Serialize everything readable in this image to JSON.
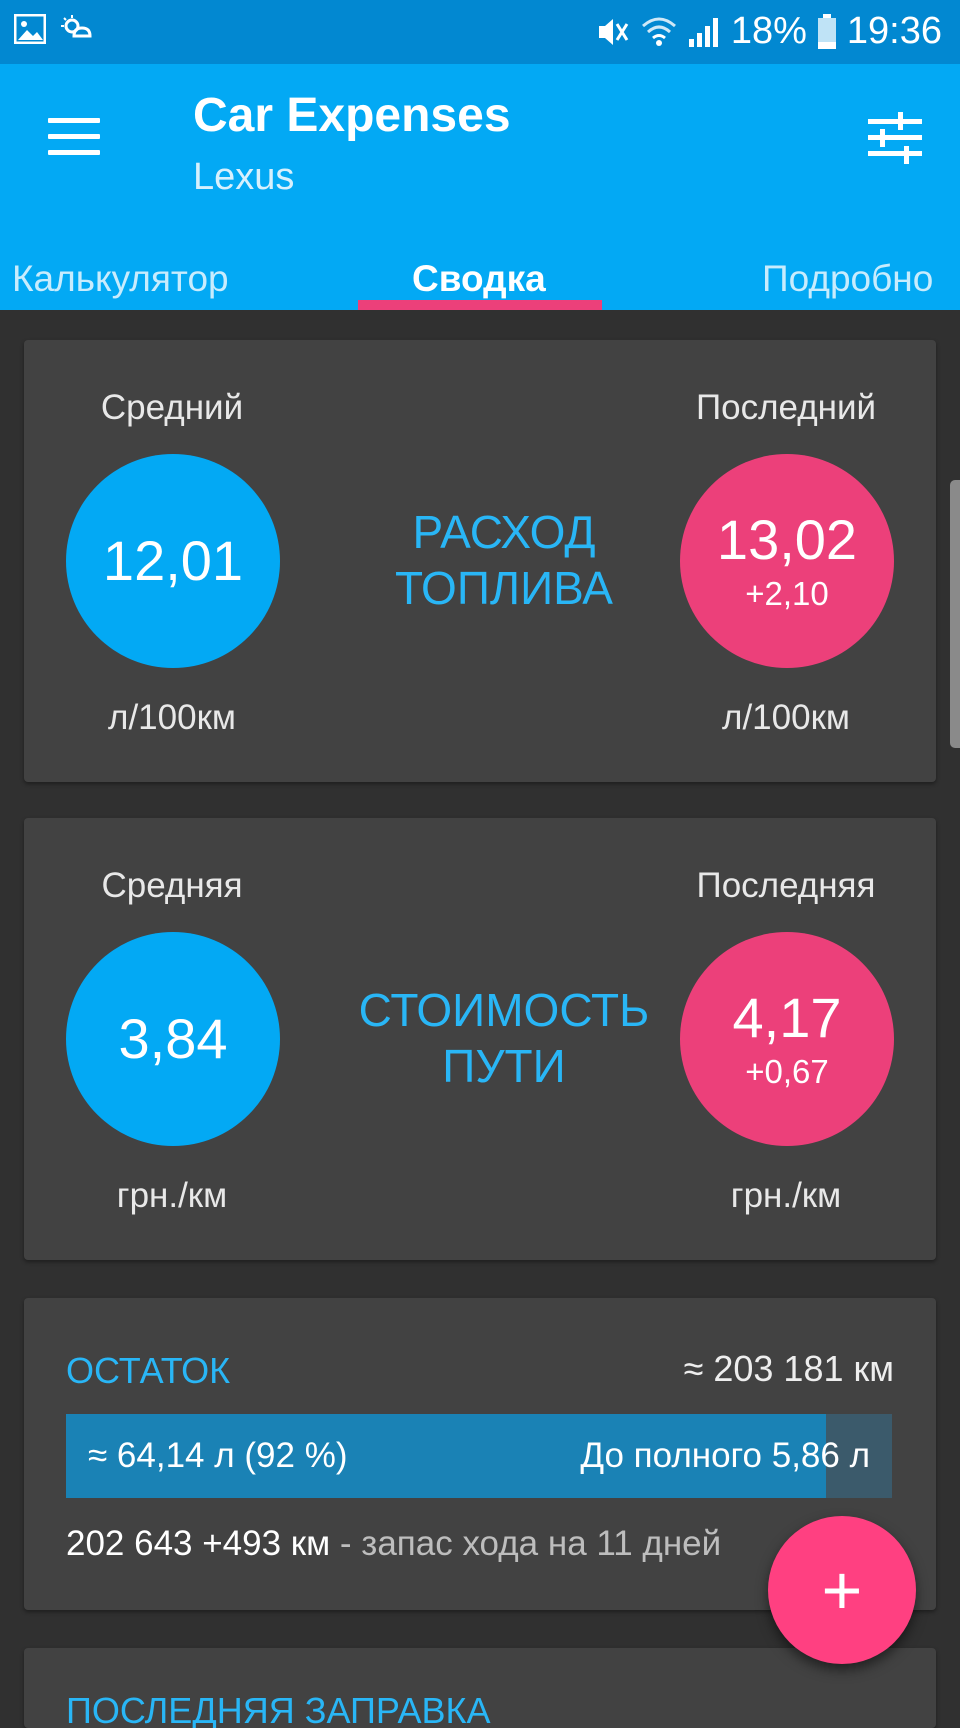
{
  "status_bar": {
    "battery": "18%",
    "time": "19:36",
    "icons": [
      "image-icon",
      "weather-icon",
      "mute-icon",
      "wifi-icon",
      "signal-icon",
      "battery-icon"
    ]
  },
  "app_bar": {
    "title": "Car Expenses",
    "subtitle": "Lexus",
    "menu_icon": "hamburger-menu-icon",
    "filter_icon": "filter-sliders-icon",
    "colors": {
      "primary": "#03a9f4",
      "accent": "#ec407a"
    }
  },
  "tabs": [
    {
      "label": "Калькулятор"
    },
    {
      "label": "Сводка",
      "active": true
    },
    {
      "label": "Подробно"
    }
  ],
  "fuel_card": {
    "left_label": "Средний",
    "right_label": "Последний",
    "avg_value": "12,01",
    "last_value": "13,02",
    "last_delta": "+2,10",
    "title_line1": "РАСХОД",
    "title_line2": "ТОПЛИВА",
    "left_unit": "л/100км",
    "right_unit": "л/100км"
  },
  "cost_card": {
    "left_label": "Средняя",
    "right_label": "Последняя",
    "avg_value": "3,84",
    "last_value": "4,17",
    "last_delta": "+0,67",
    "title_line1": "СТОИМОСТЬ",
    "title_line2": "ПУТИ",
    "left_unit": "грн./км",
    "right_unit": "грн./км"
  },
  "remaining_card": {
    "title": "ОСТАТОК",
    "odometer": "≈ 203 181 км",
    "fuel_level_text": "≈ 64,14 л (92 %)",
    "fuel_level_fraction": 0.92,
    "to_full_text": "До полного 5,86 л",
    "range_value": "202 643 +493 км",
    "range_suffix": " - запас хода на 11 дней"
  },
  "last_refuel_card": {
    "title": "ПОСЛЕДНЯЯ ЗАПРАВКА"
  },
  "fab": {
    "label": "+"
  }
}
